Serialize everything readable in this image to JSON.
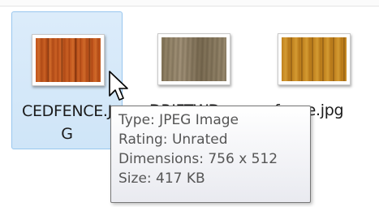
{
  "files": [
    {
      "name_line1": "CEDFENCE.J",
      "name_line2": "G",
      "selected": true,
      "thumb_color": "#c0541c"
    },
    {
      "name_line1": "DRIFTWD",
      "name_line2": "",
      "selected": false,
      "thumb_color": "#9a8b70"
    },
    {
      "name_line1": "fence.jpg",
      "name_line2": "",
      "selected": false,
      "thumb_color": "#c98a24"
    }
  ],
  "tooltip": {
    "type": "Type: JPEG Image",
    "rating": "Rating: Unrated",
    "dimensions": "Dimensions: 756 x 512",
    "size": "Size: 417 KB"
  },
  "colors": {
    "selection_background": "#cfe5f8",
    "selection_border": "#99c7ef",
    "tooltip_text": "#555555"
  }
}
